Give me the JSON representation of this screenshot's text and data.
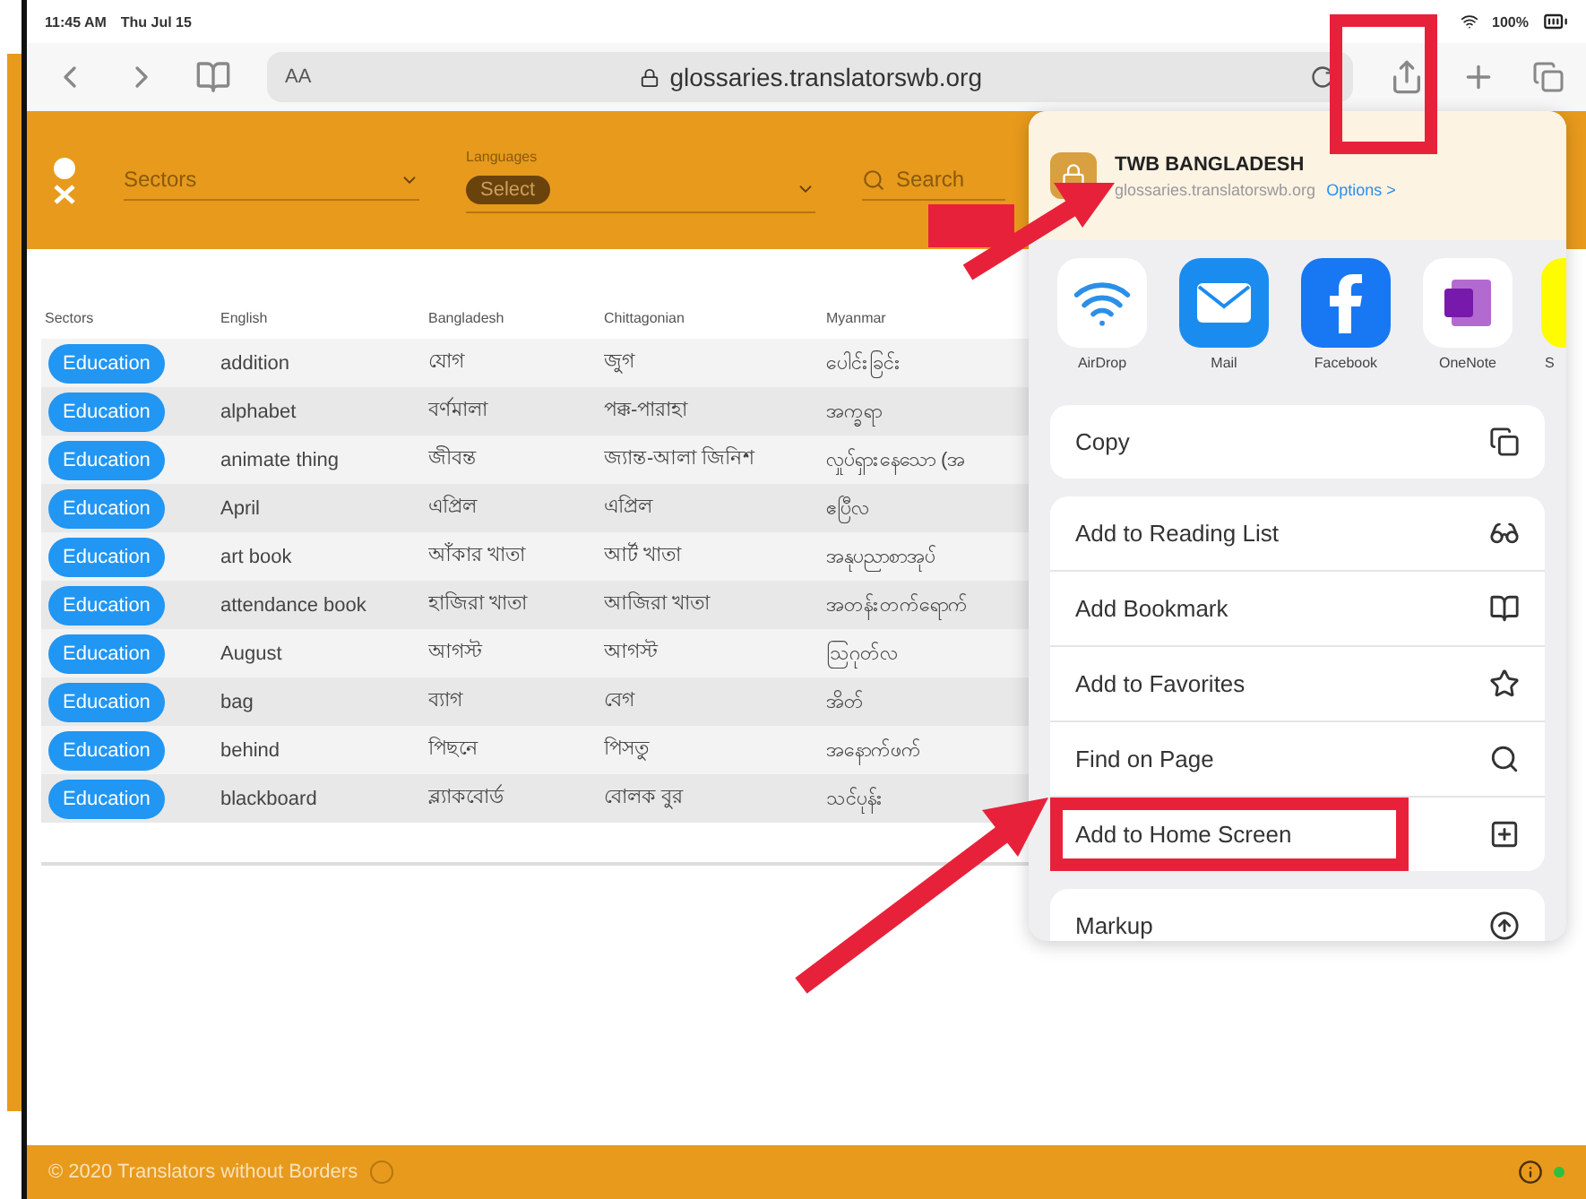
{
  "status_bar": {
    "time": "11:45 AM",
    "date": "Thu Jul 15",
    "battery": "100%"
  },
  "browser_toolbar": {
    "text_size": "AA",
    "url": "glossaries.translatorswb.org"
  },
  "header": {
    "sectors": {
      "placeholder": "Sectors"
    },
    "languages": {
      "label": "Languages",
      "chip": "Select"
    },
    "search": {
      "placeholder": "Search"
    }
  },
  "table": {
    "columns": [
      "Sectors",
      "English",
      "Bangladesh",
      "Chittagonian",
      "Myanmar"
    ],
    "rows": [
      {
        "cells": [
          "Education",
          "addition",
          "যোগ",
          "জুগ",
          "ပေါင်းခြင်း"
        ]
      },
      {
        "cells": [
          "Education",
          "alphabet",
          "বর্ণমালা",
          "পক্ক-পারাহা",
          "အက္ခရာ"
        ]
      },
      {
        "cells": [
          "Education",
          "animate thing",
          "জীবন্ত",
          "জ্যান্ত-আলা জিনিশ",
          "လှုပ်ရှားနေသော (အ"
        ]
      },
      {
        "cells": [
          "Education",
          "April",
          "এপ্রিল",
          "এপ্রিল",
          "ဧပြီလ"
        ]
      },
      {
        "cells": [
          "Education",
          "art book",
          "আঁকার খাতা",
          "আর্ট খাতা",
          "အနုပညာစာအုပ်"
        ]
      },
      {
        "cells": [
          "Education",
          "attendance book",
          "হাজিরা খাতা",
          "আজিরা খাতা",
          "အတန်းတက်ရောက်"
        ]
      },
      {
        "cells": [
          "Education",
          "August",
          "আগস্ট",
          "আগস্ট",
          "ဩဂုတ်လ"
        ]
      },
      {
        "cells": [
          "Education",
          "bag",
          "ব্যাগ",
          "বেগ",
          "အိတ်"
        ]
      },
      {
        "cells": [
          "Education",
          "behind",
          "পিছনে",
          "পিসতু",
          "အနောက်ဖက်"
        ]
      },
      {
        "cells": [
          "Education",
          "blackboard",
          "ব্ল্যাকবোর্ড",
          "বোলক বুর",
          "သင်ပုန်း"
        ]
      }
    ]
  },
  "share_sheet": {
    "title": "TWB BANGLADESH",
    "subtitle": "glossaries.translatorswb.org",
    "options_link": "Options >",
    "apps": [
      {
        "kind": "airdrop",
        "label": "AirDrop"
      },
      {
        "kind": "mail",
        "label": "Mail"
      },
      {
        "kind": "facebook",
        "label": "Facebook"
      },
      {
        "kind": "onenote",
        "label": "OneNote"
      },
      {
        "kind": "snapchat",
        "label": "S"
      }
    ],
    "action_groups": [
      [
        {
          "kind": "copy",
          "label": "Copy"
        }
      ],
      [
        {
          "kind": "reading",
          "label": "Add to Reading List"
        },
        {
          "kind": "bookmark",
          "label": "Add Bookmark"
        },
        {
          "kind": "favorite",
          "label": "Add to Favorites"
        },
        {
          "kind": "find",
          "label": "Find on Page"
        },
        {
          "kind": "home",
          "label": "Add to Home Screen",
          "highlighted": true
        }
      ],
      [
        {
          "kind": "markup",
          "label": "Markup"
        }
      ]
    ]
  },
  "footer": {
    "copyright": "© 2020 Translators without Borders"
  }
}
